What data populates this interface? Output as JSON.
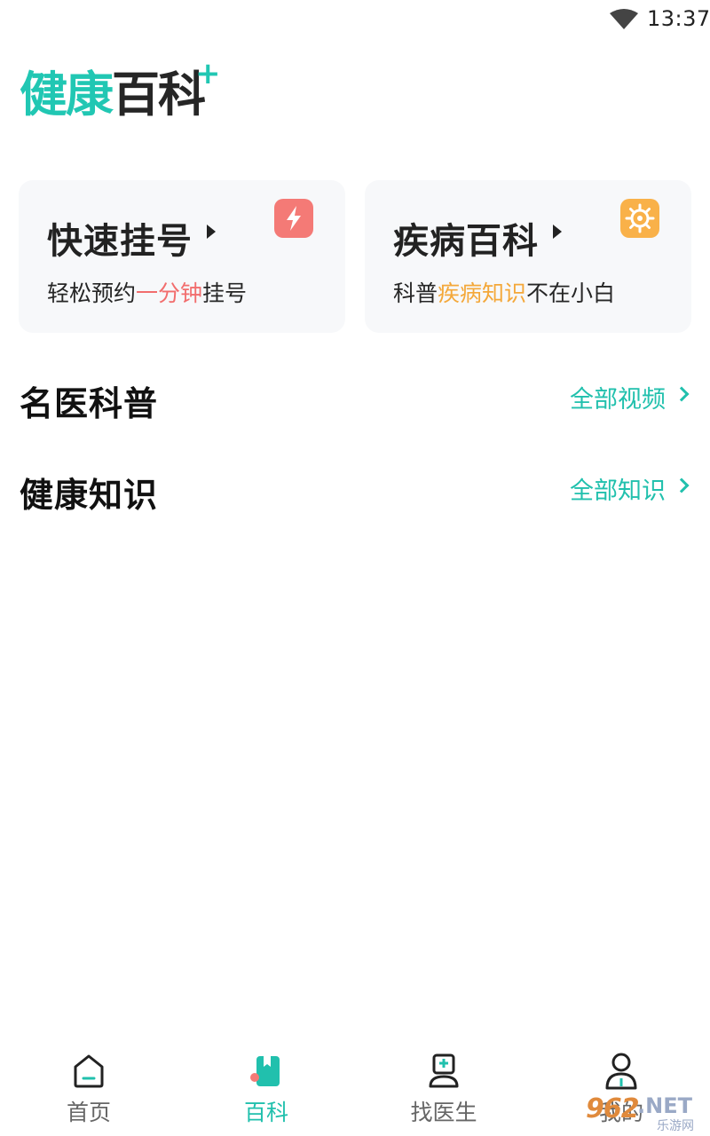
{
  "status_bar": {
    "time": "13:37"
  },
  "header": {
    "logo_part1": "健康",
    "logo_part2": "百科",
    "logo_plus": "+"
  },
  "cards": [
    {
      "title": "快速挂号",
      "sub_before": "轻松预约",
      "sub_highlight": "一分钟",
      "sub_after": "挂号",
      "icon": "lightning-icon",
      "accent": "#f47a76"
    },
    {
      "title": "疾病百科",
      "sub_before": "科普",
      "sub_highlight": "疾病知识",
      "sub_after": "不在小白",
      "icon": "virus-icon",
      "accent": "#f9b149"
    }
  ],
  "sections": [
    {
      "title": "名医科普",
      "link": "全部视频"
    },
    {
      "title": "健康知识",
      "link": "全部知识"
    }
  ],
  "tabbar": {
    "items": [
      {
        "label": "首页",
        "icon": "home-icon",
        "active": false
      },
      {
        "label": "百科",
        "icon": "book-icon",
        "active": true
      },
      {
        "label": "找医生",
        "icon": "doctor-icon",
        "active": false
      },
      {
        "label": "我的",
        "icon": "user-icon",
        "active": false
      }
    ]
  },
  "watermark": {
    "brand": "962",
    "suffix": ".NET",
    "sub": "乐游网"
  },
  "colors": {
    "accent": "#21c0ad",
    "text": "#1a1a1a",
    "card_bg": "#f7f8fa"
  }
}
